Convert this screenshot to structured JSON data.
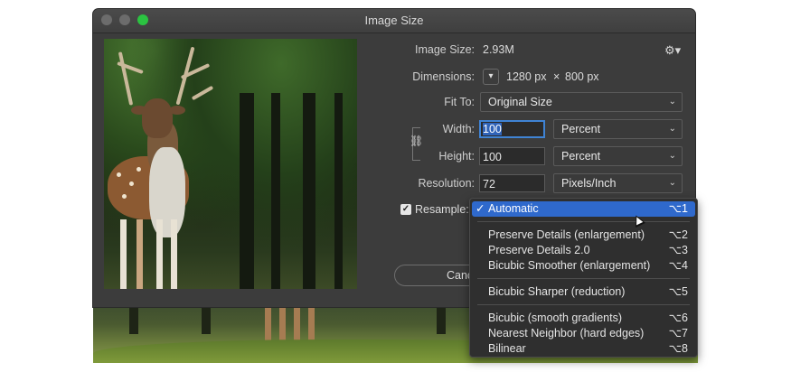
{
  "window": {
    "title": "Image Size"
  },
  "info": {
    "image_size_label": "Image Size:",
    "image_size_value": "2.93M",
    "dimensions_label": "Dimensions:",
    "dim_width": "1280 px",
    "dim_sep": "×",
    "dim_height": "800 px"
  },
  "fit_to": {
    "label": "Fit To:",
    "value": "Original Size"
  },
  "width": {
    "label": "Width:",
    "value": "100",
    "unit": "Percent"
  },
  "height": {
    "label": "Height:",
    "value": "100",
    "unit": "Percent"
  },
  "resolution": {
    "label": "Resolution:",
    "value": "72",
    "unit": "Pixels/Inch"
  },
  "resample": {
    "label": "Resample:",
    "checked": true
  },
  "buttons": {
    "cancel": "Canc"
  },
  "resample_menu": {
    "items": [
      {
        "label": "Automatic",
        "shortcut": "⌥1",
        "selected": true
      },
      {
        "label": "Preserve Details (enlargement)",
        "shortcut": "⌥2"
      },
      {
        "label": "Preserve Details 2.0",
        "shortcut": "⌥3"
      },
      {
        "label": "Bicubic Smoother (enlargement)",
        "shortcut": "⌥4"
      },
      {
        "label": "Bicubic Sharper (reduction)",
        "shortcut": "⌥5"
      },
      {
        "label": "Bicubic (smooth gradients)",
        "shortcut": "⌥6"
      },
      {
        "label": "Nearest Neighbor (hard edges)",
        "shortcut": "⌥7"
      },
      {
        "label": "Bilinear",
        "shortcut": "⌥8"
      }
    ]
  },
  "colors": {
    "accent": "#2f69cc",
    "dialog_bg": "#3c3c3c",
    "max_button": "#2bc341"
  }
}
